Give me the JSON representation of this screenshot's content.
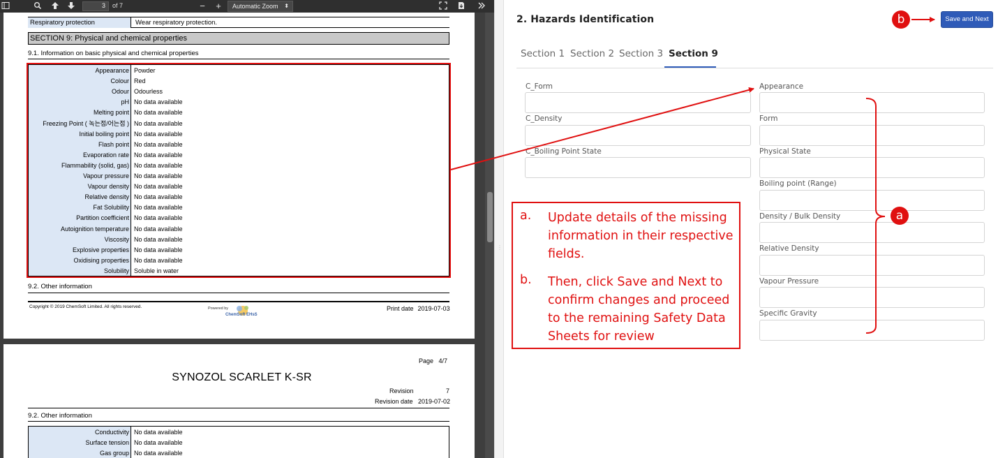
{
  "viewer": {
    "page_number": "3",
    "page_count": "of 7",
    "zoom": "Automatic Zoom",
    "icons": [
      "sidebar-toggle-icon",
      "search-icon",
      "previous-page-icon",
      "next-page-icon",
      "zoom-out-icon",
      "zoom-in-icon",
      "chevron-down-icon",
      "fullscreen-icon",
      "download-icon",
      "more-tools-icon"
    ],
    "zoom_out": "−",
    "zoom_in": "+",
    "caret": "⬍"
  },
  "pdf_page1": {
    "resp_label": "Respiratory protection",
    "resp_value": "Wear respiratory protection.",
    "section_title": "SECTION 9: Physical and chemical properties",
    "subheading_1": "9.1. Information on basic physical and chemical properties",
    "properties": [
      {
        "label": "Appearance",
        "value": "Powder"
      },
      {
        "label": "Colour",
        "value": "Red"
      },
      {
        "label": "Odour",
        "value": "Odourless"
      },
      {
        "label": "pH",
        "value": "No data available"
      },
      {
        "label": "Melting point",
        "value": "No data available"
      },
      {
        "label": "Freezing Point ( 녹는점/어는점 )",
        "value": "No data available"
      },
      {
        "label": "Initial boiling point",
        "value": "No data available"
      },
      {
        "label": "Flash point",
        "value": "No data available"
      },
      {
        "label": "Evaporation rate",
        "value": "No data available"
      },
      {
        "label": "Flammability (solid, gas)",
        "value": "No data available"
      },
      {
        "label": "Vapour pressure",
        "value": "No data available"
      },
      {
        "label": "Vapour density",
        "value": "No data available"
      },
      {
        "label": "Relative density",
        "value": "No data available"
      },
      {
        "label": "Fat Solubility",
        "value": "No data available"
      },
      {
        "label": "Partition coefficient",
        "value": "No data available"
      },
      {
        "label": "Autoignition temperature",
        "value": "No data available"
      },
      {
        "label": "Viscosity",
        "value": "No data available"
      },
      {
        "label": "Explosive properties",
        "value": "No data available"
      },
      {
        "label": "Oxidising properties",
        "value": "No data available"
      },
      {
        "label": "Solubility",
        "value": "Soluble in water"
      }
    ],
    "subheading_2": "9.2. Other information",
    "copyright": "Copyright © 2019 ChemSoft Limited.  All rights reserved.",
    "powered_by": "Powered by",
    "logo_text": "ChemSoft EHsS",
    "print_date_label": "Print date",
    "print_date_value": "2019-07-03"
  },
  "pdf_page2": {
    "page_label": "Page",
    "page_value": "4/7",
    "title": "SYNOZOL SCARLET K-SR",
    "revision_label": "Revision",
    "revision_value": "7",
    "revision_date_label": "Revision date",
    "revision_date_value": "2019-07-02",
    "subheading": "9.2. Other information",
    "properties": [
      {
        "label": "Conductivity",
        "value": "No data available"
      },
      {
        "label": "Surface tension",
        "value": "No data available"
      },
      {
        "label": "Gas group",
        "value": "No data available"
      }
    ]
  },
  "form": {
    "title": "2. Hazards Identification",
    "save_label": "Save and Next",
    "tabs": [
      "Section 1",
      "Section 2",
      "Section 3",
      "Section 9"
    ],
    "active_tab": "Section 9",
    "left_fields": [
      {
        "label": "C_Form",
        "value": ""
      },
      {
        "label": "C_Density",
        "value": ""
      },
      {
        "label": "C_Boiling Point State",
        "value": ""
      }
    ],
    "right_fields": [
      {
        "label": "Appearance",
        "value": ""
      },
      {
        "label": "Form",
        "value": ""
      },
      {
        "label": "Physical State",
        "value": ""
      },
      {
        "label": "Boiling point (Range)",
        "value": ""
      },
      {
        "label": "Density / Bulk Density",
        "value": ""
      },
      {
        "label": "Relative Density",
        "value": ""
      },
      {
        "label": "Vapour Pressure",
        "value": ""
      },
      {
        "label": "Specific Gravity",
        "value": ""
      }
    ]
  },
  "annotations": {
    "accent_color": "#e01010",
    "callout_a": "a",
    "callout_b": "b",
    "instructions": [
      {
        "mark": "a.",
        "text": "Update details of the missing information in their respective fields."
      },
      {
        "mark": "b.",
        "text": "Then, click Save and Next to confirm changes and proceed to the remaining Safety Data Sheets for review"
      }
    ]
  },
  "colors": {
    "button_blue": "#2f5bb8",
    "label_cell_blue": "#dce7f5",
    "viewer_dark": "#3e3e3e"
  }
}
